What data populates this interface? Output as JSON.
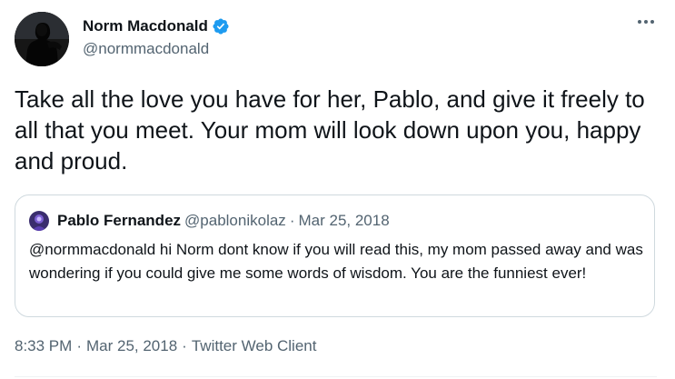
{
  "author": {
    "name": "Norm Macdonald",
    "handle": "@normmacdonald",
    "verified": true
  },
  "tweet": {
    "text": "Take all the love you have for her, Pablo, and give it freely to all that you meet. Your mom will look down upon you, happy and proud."
  },
  "quoted_tweet": {
    "name": "Pablo Fernandez",
    "handle": "@pablonikolaz",
    "separator": "·",
    "date": "Mar 25, 2018",
    "text": "@normmacdonald hi Norm dont know if you will read this, my mom passed away and was wondering if you could give me some words of wisdom. You are the funniest ever!"
  },
  "meta": {
    "time": "8:33 PM",
    "sep1": "·",
    "date": "Mar 25, 2018",
    "sep2": "·",
    "client": "Twitter Web Client"
  },
  "icons": {
    "verified": "verified-badge-icon",
    "more": "more-options-icon"
  },
  "colors": {
    "primary_text": "#0f1419",
    "secondary_text": "#536471",
    "verified_blue": "#1d9bf0",
    "border": "#cfd9de"
  }
}
